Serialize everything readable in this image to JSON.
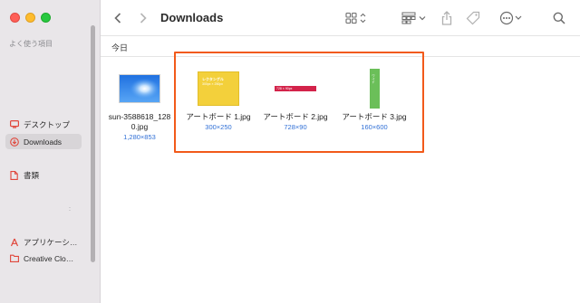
{
  "window": {
    "title": "Downloads"
  },
  "sidebar": {
    "section_title": "よく使う項目",
    "items": [
      {
        "label": "デスクトップ",
        "icon": "desktop-icon"
      },
      {
        "label": "Downloads",
        "icon": "download-icon",
        "active": true
      },
      {
        "label": "書類",
        "icon": "document-icon"
      },
      {
        "label": "アプリケーシ…",
        "icon": "applications-icon"
      },
      {
        "label": "Creative Clo…",
        "icon": "folder-icon"
      }
    ],
    "mark": ":"
  },
  "toolbar": {
    "back": "back-icon",
    "forward": "forward-icon",
    "view": "grid-view-icon",
    "group": "group-icon",
    "share": "share-icon",
    "tag": "tag-icon",
    "more": "more-icon",
    "search": "search-icon"
  },
  "group": {
    "label": "今日"
  },
  "files": [
    {
      "name_line1": "sun-3588618_128",
      "name_line2": "0.jpg",
      "dims": "1,280×853"
    },
    {
      "name_line1": "アートボード 1.jpg",
      "name_line2": "",
      "dims": "300×250",
      "banner_text1": "レクタングル",
      "banner_text2": "300px × 250px"
    },
    {
      "name_line1": "アートボード 2.jpg",
      "name_line2": "",
      "dims": "728×90",
      "banner_text1": "728 × 90px"
    },
    {
      "name_line1": "アートボード 3.jpg",
      "name_line2": "",
      "dims": "160×600",
      "banner_text1": "ワイド"
    }
  ],
  "colors": {
    "sidebar_bg": "#e9e6e9",
    "accent_blue": "#2f6fd6",
    "highlight": "#f25a1a",
    "yellow_banner": "#f3d03b",
    "red_banner": "#d3234a",
    "green_banner": "#6bbf59"
  }
}
